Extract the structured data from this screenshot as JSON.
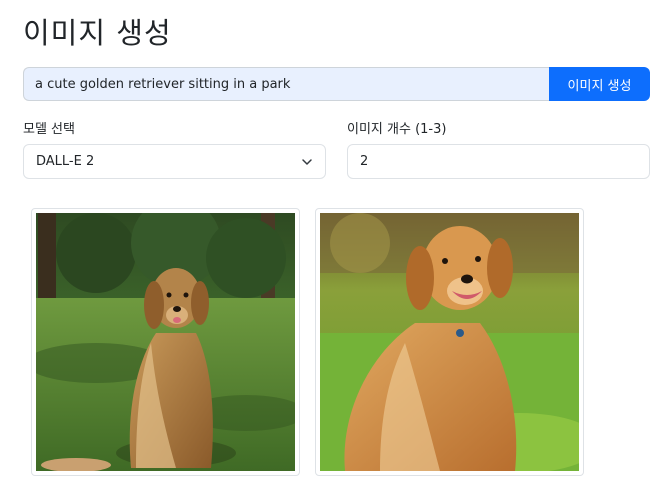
{
  "page": {
    "title": "이미지 생성"
  },
  "prompt": {
    "value": "a cute golden retriever sitting in a park"
  },
  "generate_button": {
    "label": "이미지 생성"
  },
  "model": {
    "label": "모델 선택",
    "selected": "DALL-E 2"
  },
  "count": {
    "label": "이미지 개수 (1-3)",
    "value": "2"
  },
  "images": [
    {
      "subject": "golden retriever sitting on grass in shaded park"
    },
    {
      "subject": "golden retriever sitting on sunny grass, smiling"
    }
  ]
}
